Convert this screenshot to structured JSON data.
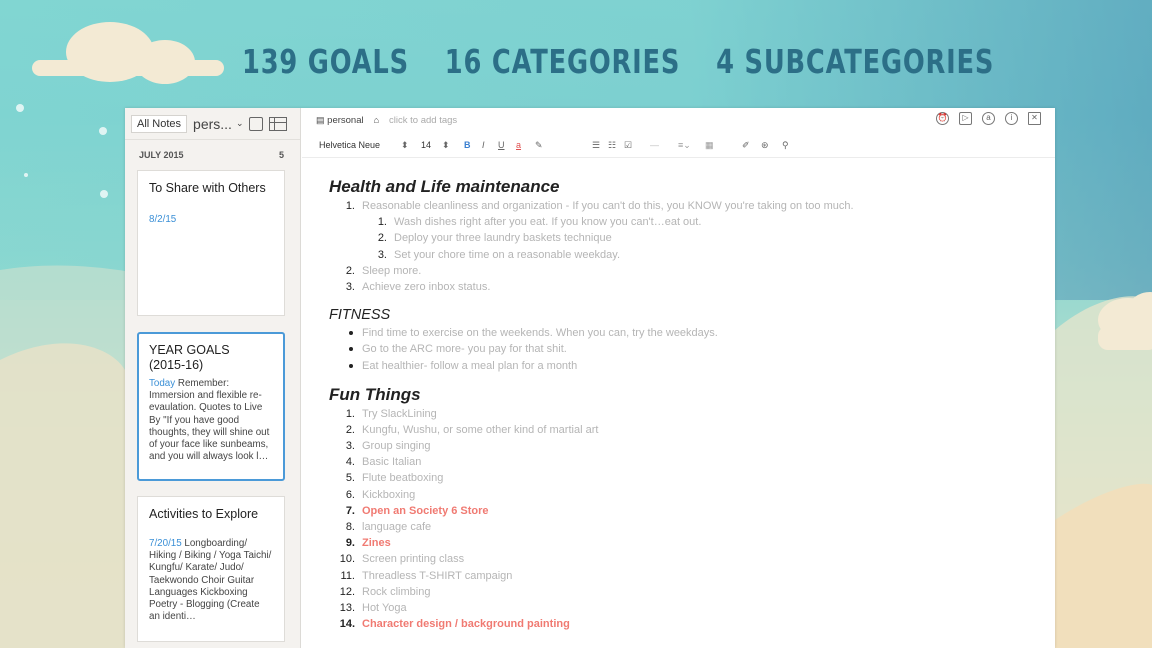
{
  "headline": [
    "139 GOALS",
    "16 CATEGORIES",
    "4 SUBCATEGORIES"
  ],
  "note_list": {
    "all_notes_label": "All Notes",
    "notebook_label": "pers...",
    "month": "JULY 2015",
    "count": "5",
    "cards": [
      {
        "title": "To Share with Others",
        "date": "8/2/15",
        "body": ""
      },
      {
        "title": "YEAR GOALS (2015-16)",
        "date": "Today",
        "body": " Remember: Immersion and flexible re-evaulation. Quotes to Live By \"If you have good thoughts, they will shine out of your face like sunbeams, and you will always look l…"
      },
      {
        "title": "Activities to Explore",
        "date": "7/20/15",
        "body": " Longboarding/ Hiking / Biking / Yoga Taichi/ Kungfu/ Karate/ Judo/ Taekwondo Choir Guitar Languages Kickboxing Poetry - Blogging (Create an identi…"
      }
    ]
  },
  "editor": {
    "notebook_tag": "personal",
    "tag_placeholder": "click to add tags",
    "font_name": "Helvetica Neue",
    "font_size": "14",
    "sections": {
      "health": {
        "title": "Health and Life maintenance",
        "items": [
          {
            "n": "1.",
            "text": "Reasonable cleanliness and organization - If you can't do this, you KNOW you're taking on too much."
          },
          {
            "n": "1.",
            "text": "Wash dishes right after you eat. If you know you can't…eat out.",
            "sub": true
          },
          {
            "n": "2.",
            "text": "Deploy your three laundry baskets technique",
            "sub": true
          },
          {
            "n": "3.",
            "text": "Set your chore time on a reasonable weekday.",
            "sub": true
          },
          {
            "n": "2.",
            "text": "Sleep more."
          },
          {
            "n": "3.",
            "text": "Achieve zero inbox status."
          }
        ]
      },
      "fitness": {
        "title": "FITNESS",
        "items": [
          "Find time to exercise on the weekends. When you can, try the weekdays.",
          "Go to the ARC more- you pay for that shit.",
          "Eat healthier- follow a meal plan for a month"
        ]
      },
      "fun": {
        "title": "Fun Things",
        "items": [
          {
            "n": "1.",
            "text": "Try SlackLining"
          },
          {
            "n": "2.",
            "text": "Kungfu, Wushu, or some other kind of martial art"
          },
          {
            "n": "3.",
            "text": "Group singing"
          },
          {
            "n": "4.",
            "text": "Basic Italian"
          },
          {
            "n": "5.",
            "text": "Flute beatboxing"
          },
          {
            "n": "6.",
            "text": "Kickboxing"
          },
          {
            "n": "7.",
            "text": "Open an Society 6 Store",
            "highlight": true
          },
          {
            "n": "8.",
            "text": "language cafe"
          },
          {
            "n": "9.",
            "text": "Zines",
            "highlight": true
          },
          {
            "n": "10.",
            "text": "Screen printing class"
          },
          {
            "n": "11.",
            "text": "Threadless T-SHIRT campaign"
          },
          {
            "n": "12.",
            "text": "Rock climbing"
          },
          {
            "n": "13.",
            "text": "Hot Yoga"
          },
          {
            "n": "14.",
            "text": "Character design / background painting",
            "highlight": true
          }
        ]
      }
    }
  },
  "colors": {
    "headline": "#2c6f87",
    "accent_blue": "#3a8fd6",
    "highlight_red": "#f07a72"
  }
}
